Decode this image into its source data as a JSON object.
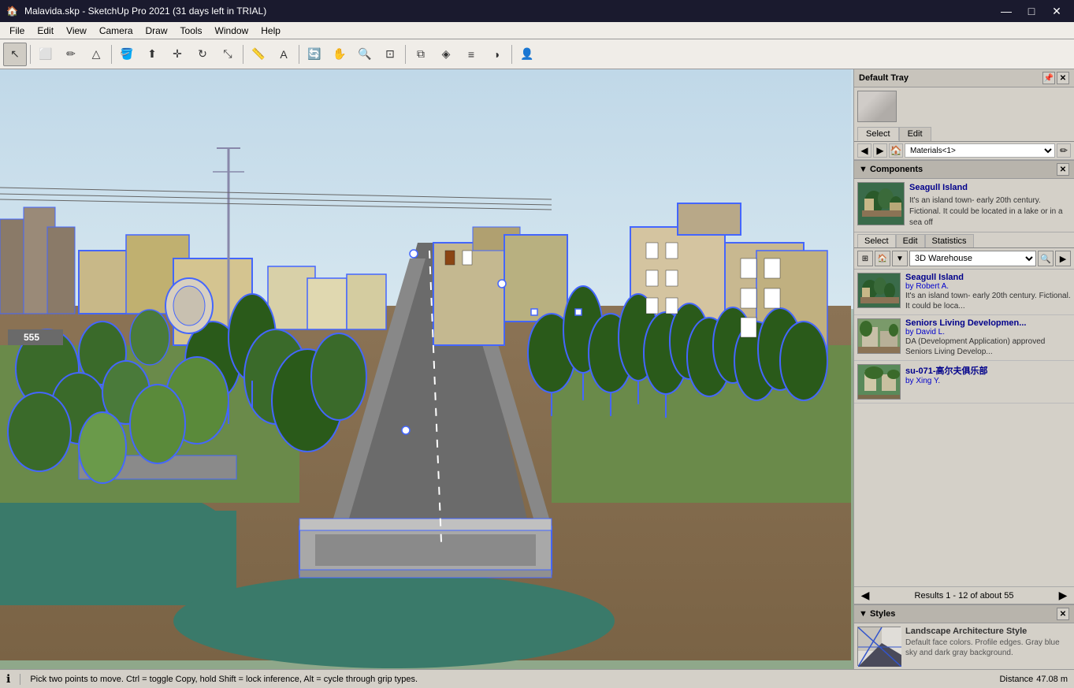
{
  "titlebar": {
    "title": "Malavida.skp - SketchUp Pro 2021 (31 days left in TRIAL)",
    "icon": "🏠",
    "minimize": "—",
    "maximize": "□",
    "close": "✕"
  },
  "menubar": {
    "items": [
      "File",
      "Edit",
      "View",
      "Camera",
      "Draw",
      "Tools",
      "Window",
      "Help"
    ]
  },
  "toolbar": {
    "tools": [
      {
        "name": "select",
        "icon": "↖",
        "title": "Select"
      },
      {
        "name": "eraser",
        "icon": "◻",
        "title": "Eraser"
      },
      {
        "name": "pencil",
        "icon": "✏",
        "title": "Pencil"
      },
      {
        "name": "shape",
        "icon": "△",
        "title": "Shape"
      },
      {
        "name": "paint",
        "icon": "🪣",
        "title": "Paint Bucket"
      },
      {
        "name": "push-pull",
        "icon": "⬆",
        "title": "Push/Pull"
      },
      {
        "name": "move",
        "icon": "✛",
        "title": "Move"
      },
      {
        "name": "rotate",
        "icon": "↻",
        "title": "Rotate"
      },
      {
        "name": "scale",
        "icon": "⤡",
        "title": "Scale"
      },
      {
        "name": "tape",
        "icon": "📏",
        "title": "Tape Measure"
      },
      {
        "name": "text",
        "icon": "A",
        "title": "Text"
      },
      {
        "name": "orbit",
        "icon": "👁",
        "title": "Orbit"
      },
      {
        "name": "pan",
        "icon": "✋",
        "title": "Pan"
      },
      {
        "name": "zoom",
        "icon": "🔍",
        "title": "Zoom"
      },
      {
        "name": "zoom-extents",
        "icon": "⊡",
        "title": "Zoom Extents"
      },
      {
        "name": "section",
        "icon": "⧉",
        "title": "Section Plane"
      },
      {
        "name": "components",
        "icon": "◈",
        "title": "Components"
      },
      {
        "name": "layer",
        "icon": "≡",
        "title": "Layers"
      },
      {
        "name": "styles",
        "icon": "◑",
        "title": "Styles"
      },
      {
        "name": "person",
        "icon": "👤",
        "title": "Add Person"
      }
    ]
  },
  "right_panel": {
    "tray_title": "Default Tray",
    "materials": {
      "tabs": [
        "Select",
        "Edit"
      ],
      "active_tab": "Select",
      "nav": {
        "back_title": "Back",
        "forward_title": "Forward",
        "home_title": "Home",
        "dropdown_value": "Materials<1>",
        "sample_title": "Sample"
      }
    },
    "components": {
      "section_title": "Components",
      "preview": {
        "title": "Seagull Island",
        "description": "It's an island town- early 20th century. Fictional. It could be located in a lake or in a sea off"
      },
      "tabs": [
        "Select",
        "Edit",
        "Statistics"
      ],
      "active_tab": "Select",
      "search": {
        "placeholder": "3D Warehouse",
        "search_icon": "🔍"
      },
      "results": [
        {
          "title": "Seagull Island",
          "author": "by Robert A.",
          "description": "It's an island town- early 20th century. Fictional. It could be loca..."
        },
        {
          "title": "Seniors Living Developmen...",
          "author": "by David L.",
          "description": "DA (Development Application) approved Seniors Living Develop..."
        },
        {
          "title": "su-071-高尔夫俱乐部",
          "author": "by Xing Y.",
          "description": ""
        }
      ],
      "results_count": "Results 1 - 12 of about 55"
    },
    "styles": {
      "section_title": "Styles",
      "style": {
        "title": "Landscape Architecture Style",
        "description": "Default face colors. Profile edges. Gray blue sky and dark gray background."
      }
    }
  },
  "statusbar": {
    "message": "Pick two points to move.  Ctrl = toggle Copy, hold Shift = lock inference, Alt = cycle through grip types.",
    "info_icon": "ℹ",
    "distance_label": "Distance",
    "distance_value": "47.08 m"
  }
}
